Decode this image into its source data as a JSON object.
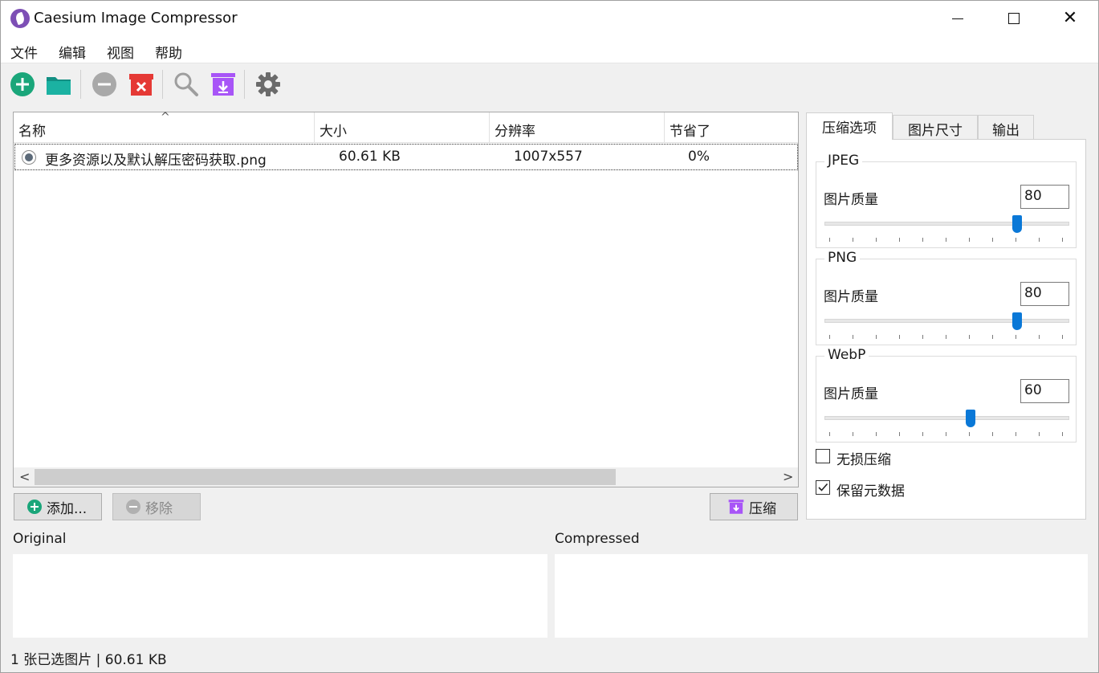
{
  "window": {
    "title": "Caesium Image Compressor"
  },
  "menu": [
    "文件",
    "编辑",
    "视图",
    "帮助"
  ],
  "toolbar": {
    "icons": [
      "add-icon",
      "folder-icon",
      "remove-icon",
      "clear-icon",
      "search-icon",
      "compress-icon",
      "settings-icon"
    ],
    "colors": {
      "green": "#1aa67a",
      "teal": "#1bb2a2",
      "red": "#e53935",
      "purple": "#a855f7",
      "grey": "#9e9e9e"
    }
  },
  "list": {
    "headers": [
      "名称",
      "大小",
      "分辨率",
      "节省了"
    ],
    "rows": [
      {
        "name": "更多资源以及默认解压密码获取.png",
        "size": "60.61 KB",
        "resolution": "1007x557",
        "saved": "0%"
      }
    ]
  },
  "buttons": {
    "add": "添加...",
    "remove": "移除",
    "compress": "压缩"
  },
  "tabs": [
    "压缩选项",
    "图片尺寸",
    "输出"
  ],
  "options": {
    "jpeg": {
      "title": "JPEG",
      "label": "图片质量",
      "value": "80",
      "level": 80
    },
    "png": {
      "title": "PNG",
      "label": "图片质量",
      "value": "80",
      "level": 80
    },
    "webp": {
      "title": "WebP",
      "label": "图片质量",
      "value": "60",
      "level": 60
    },
    "lossless": {
      "label": "无损压缩",
      "checked": false
    },
    "keep_metadata": {
      "label": "保留元数据",
      "checked": true
    }
  },
  "preview": {
    "original": "Original",
    "compressed": "Compressed"
  },
  "status": "1 张已选图片 | 60.61 KB"
}
